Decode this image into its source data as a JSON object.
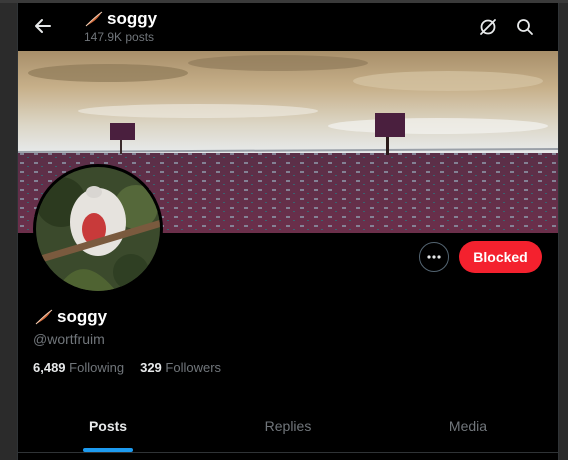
{
  "header": {
    "title": "soggy",
    "posts_count": "147.9K posts"
  },
  "icons": {
    "back": "arrow-left-icon",
    "notifications": "bell-off-icon",
    "search": "search-icon",
    "name_emoji": "feather-icon",
    "more": "more-horizontal-icon"
  },
  "profile": {
    "display_name": "soggy",
    "handle": "@wortfruim",
    "following_count": "6,489",
    "following_label": "Following",
    "followers_count": "329",
    "followers_label": "Followers"
  },
  "actions": {
    "blocked_label": "Blocked"
  },
  "tabs": [
    {
      "label": "Posts",
      "active": true
    },
    {
      "label": "Replies",
      "active": false
    },
    {
      "label": "Media",
      "active": false
    }
  ],
  "colors": {
    "background": "#000000",
    "blocked": "#f4212e",
    "tab_accent": "#1d9bf0",
    "secondary_text": "#71767b"
  }
}
